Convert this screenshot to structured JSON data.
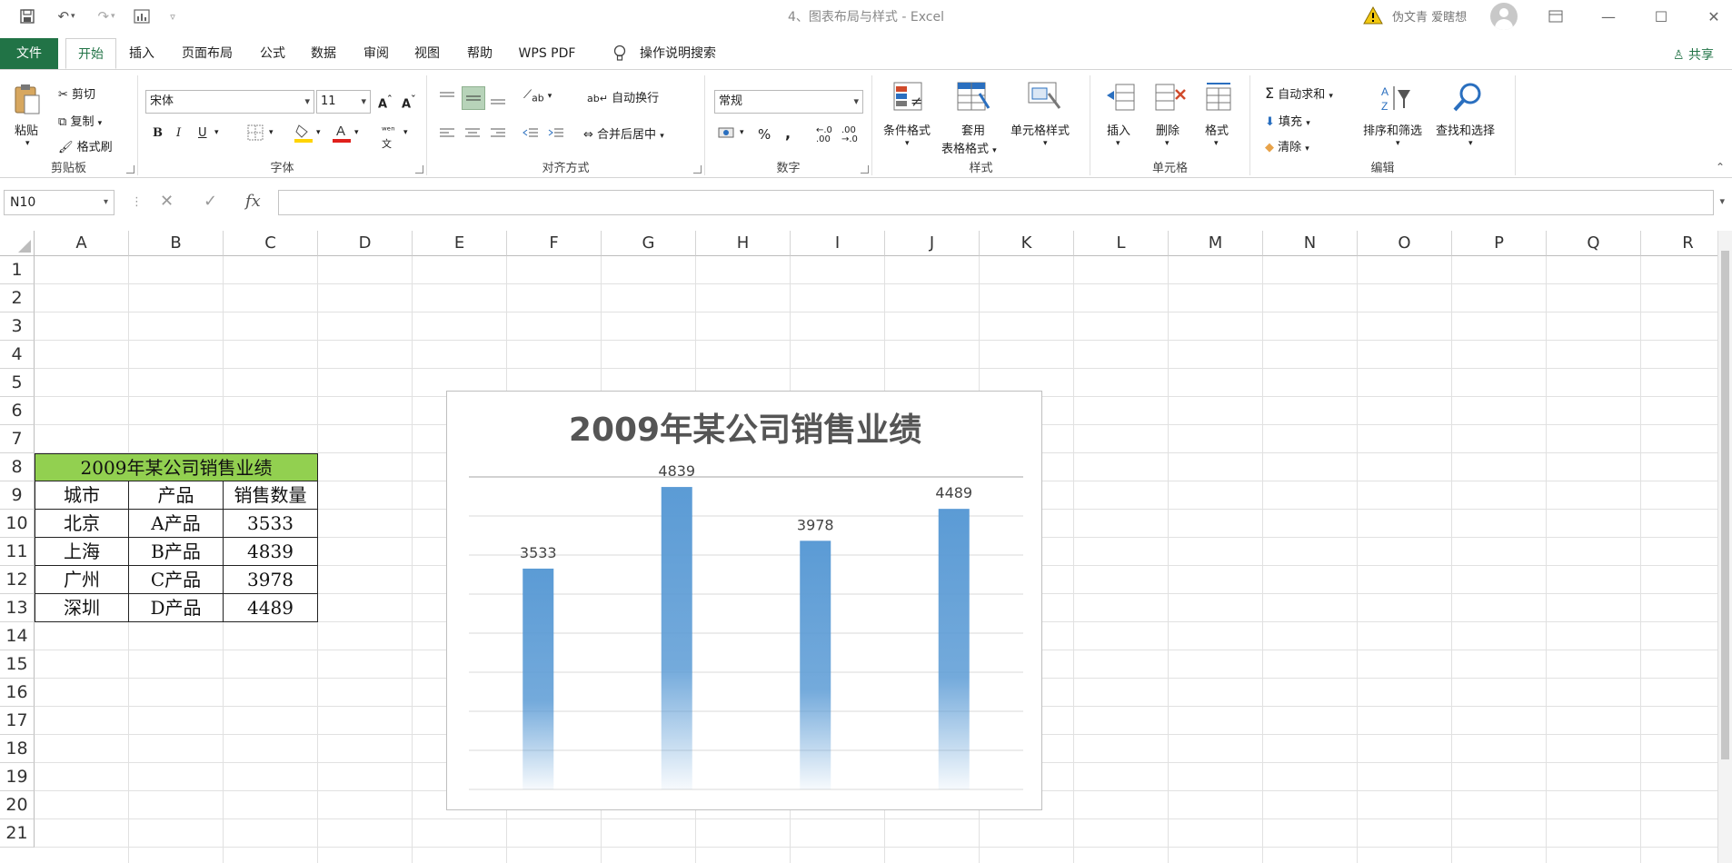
{
  "window": {
    "title": "4、图表布局与样式 - Excel",
    "user": "伪文青 爱瞎想"
  },
  "tabs": [
    {
      "label": "文件"
    },
    {
      "label": "开始"
    },
    {
      "label": "插入"
    },
    {
      "label": "页面布局"
    },
    {
      "label": "公式"
    },
    {
      "label": "数据"
    },
    {
      "label": "审阅"
    },
    {
      "label": "视图"
    },
    {
      "label": "帮助"
    },
    {
      "label": "WPS PDF"
    },
    {
      "label": "操作说明搜索"
    }
  ],
  "share_label": "共享",
  "ribbon": {
    "clipboard": {
      "paste": "粘贴",
      "cut": "剪切",
      "copy": "复制",
      "format_painter": "格式刷",
      "label": "剪贴板"
    },
    "font": {
      "name": "宋体",
      "size": "11",
      "label": "字体",
      "bold": "B",
      "italic": "I",
      "underline": "U"
    },
    "alignment": {
      "wrap": "自动换行",
      "merge": "合并后居中",
      "label": "对齐方式"
    },
    "number": {
      "format": "常规",
      "label": "数字",
      "percent": "%",
      "comma": ","
    },
    "styles": {
      "conditional": "条件格式",
      "table_line1": "套用",
      "table_line2": "表格格式",
      "cell_styles": "单元格样式",
      "label": "样式"
    },
    "cells": {
      "insert": "插入",
      "delete": "删除",
      "format": "格式",
      "label": "单元格"
    },
    "editing": {
      "autosum": "自动求和",
      "fill": "填充",
      "clear": "清除",
      "sort": "排序和筛选",
      "find": "查找和选择",
      "label": "编辑"
    }
  },
  "formula_bar": {
    "name_box": "N10",
    "fx": "fx",
    "value": ""
  },
  "columns": [
    "A",
    "B",
    "C",
    "D",
    "E",
    "F",
    "G",
    "H",
    "I",
    "J",
    "K",
    "L",
    "M",
    "N",
    "O",
    "P",
    "Q",
    "R"
  ],
  "rows": [
    "1",
    "2",
    "3",
    "4",
    "5",
    "6",
    "7",
    "8",
    "9",
    "10",
    "11",
    "12",
    "13",
    "14",
    "15",
    "16",
    "17",
    "18",
    "19",
    "20",
    "21"
  ],
  "table": {
    "title": "2009年某公司销售业绩",
    "headers": [
      "城市",
      "产品",
      "销售数量"
    ],
    "rows": [
      [
        "北京",
        "A产品",
        "3533"
      ],
      [
        "上海",
        "B产品",
        "4839"
      ],
      [
        "广州",
        "C产品",
        "3978"
      ],
      [
        "深圳",
        "D产品",
        "4489"
      ]
    ],
    "title_fill": "#92d050"
  },
  "chart_data": {
    "type": "bar",
    "title": "2009年某公司销售业绩",
    "categories": [
      "",
      "",
      "",
      ""
    ],
    "values": [
      3533,
      4839,
      3978,
      4489
    ],
    "ylim": [
      0,
      5000
    ],
    "grid": true,
    "legend": "none",
    "bar_color": "#5b9bd5"
  }
}
